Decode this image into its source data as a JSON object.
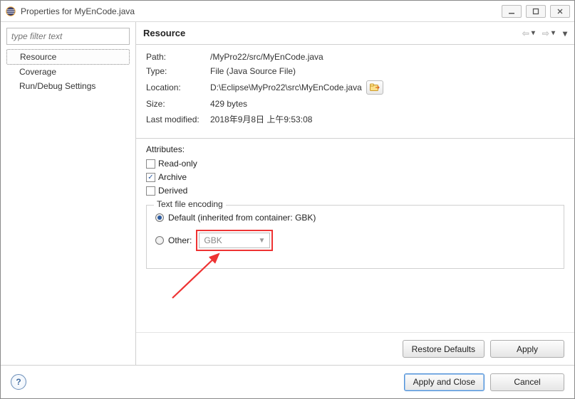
{
  "window": {
    "title": "Properties for MyEnCode.java"
  },
  "sidebar": {
    "filter_placeholder": "type filter text",
    "items": [
      {
        "label": "Resource",
        "selected": true
      },
      {
        "label": "Coverage",
        "selected": false
      },
      {
        "label": "Run/Debug Settings",
        "selected": false
      }
    ]
  },
  "header": {
    "title": "Resource"
  },
  "properties": {
    "path_label": "Path:",
    "path_value": "/MyPro22/src/MyEnCode.java",
    "type_label": "Type:",
    "type_value": "File  (Java Source File)",
    "location_label": "Location:",
    "location_value": "D:\\Eclipse\\MyPro22\\src\\MyEnCode.java",
    "size_label": "Size:",
    "size_value": "429  bytes",
    "modified_label": "Last modified:",
    "modified_value": "2018年9月8日 上午9:53:08"
  },
  "attributes": {
    "heading": "Attributes:",
    "readonly_label": "Read-only",
    "readonly_checked": false,
    "archive_label": "Archive",
    "archive_checked": true,
    "derived_label": "Derived",
    "derived_checked": false
  },
  "encoding": {
    "legend": "Text file encoding",
    "default_label": "Default (inherited from container: GBK)",
    "default_selected": true,
    "other_label": "Other:",
    "other_selected": false,
    "other_value": "GBK"
  },
  "buttons": {
    "restore": "Restore Defaults",
    "apply": "Apply",
    "apply_close": "Apply and Close",
    "cancel": "Cancel"
  }
}
